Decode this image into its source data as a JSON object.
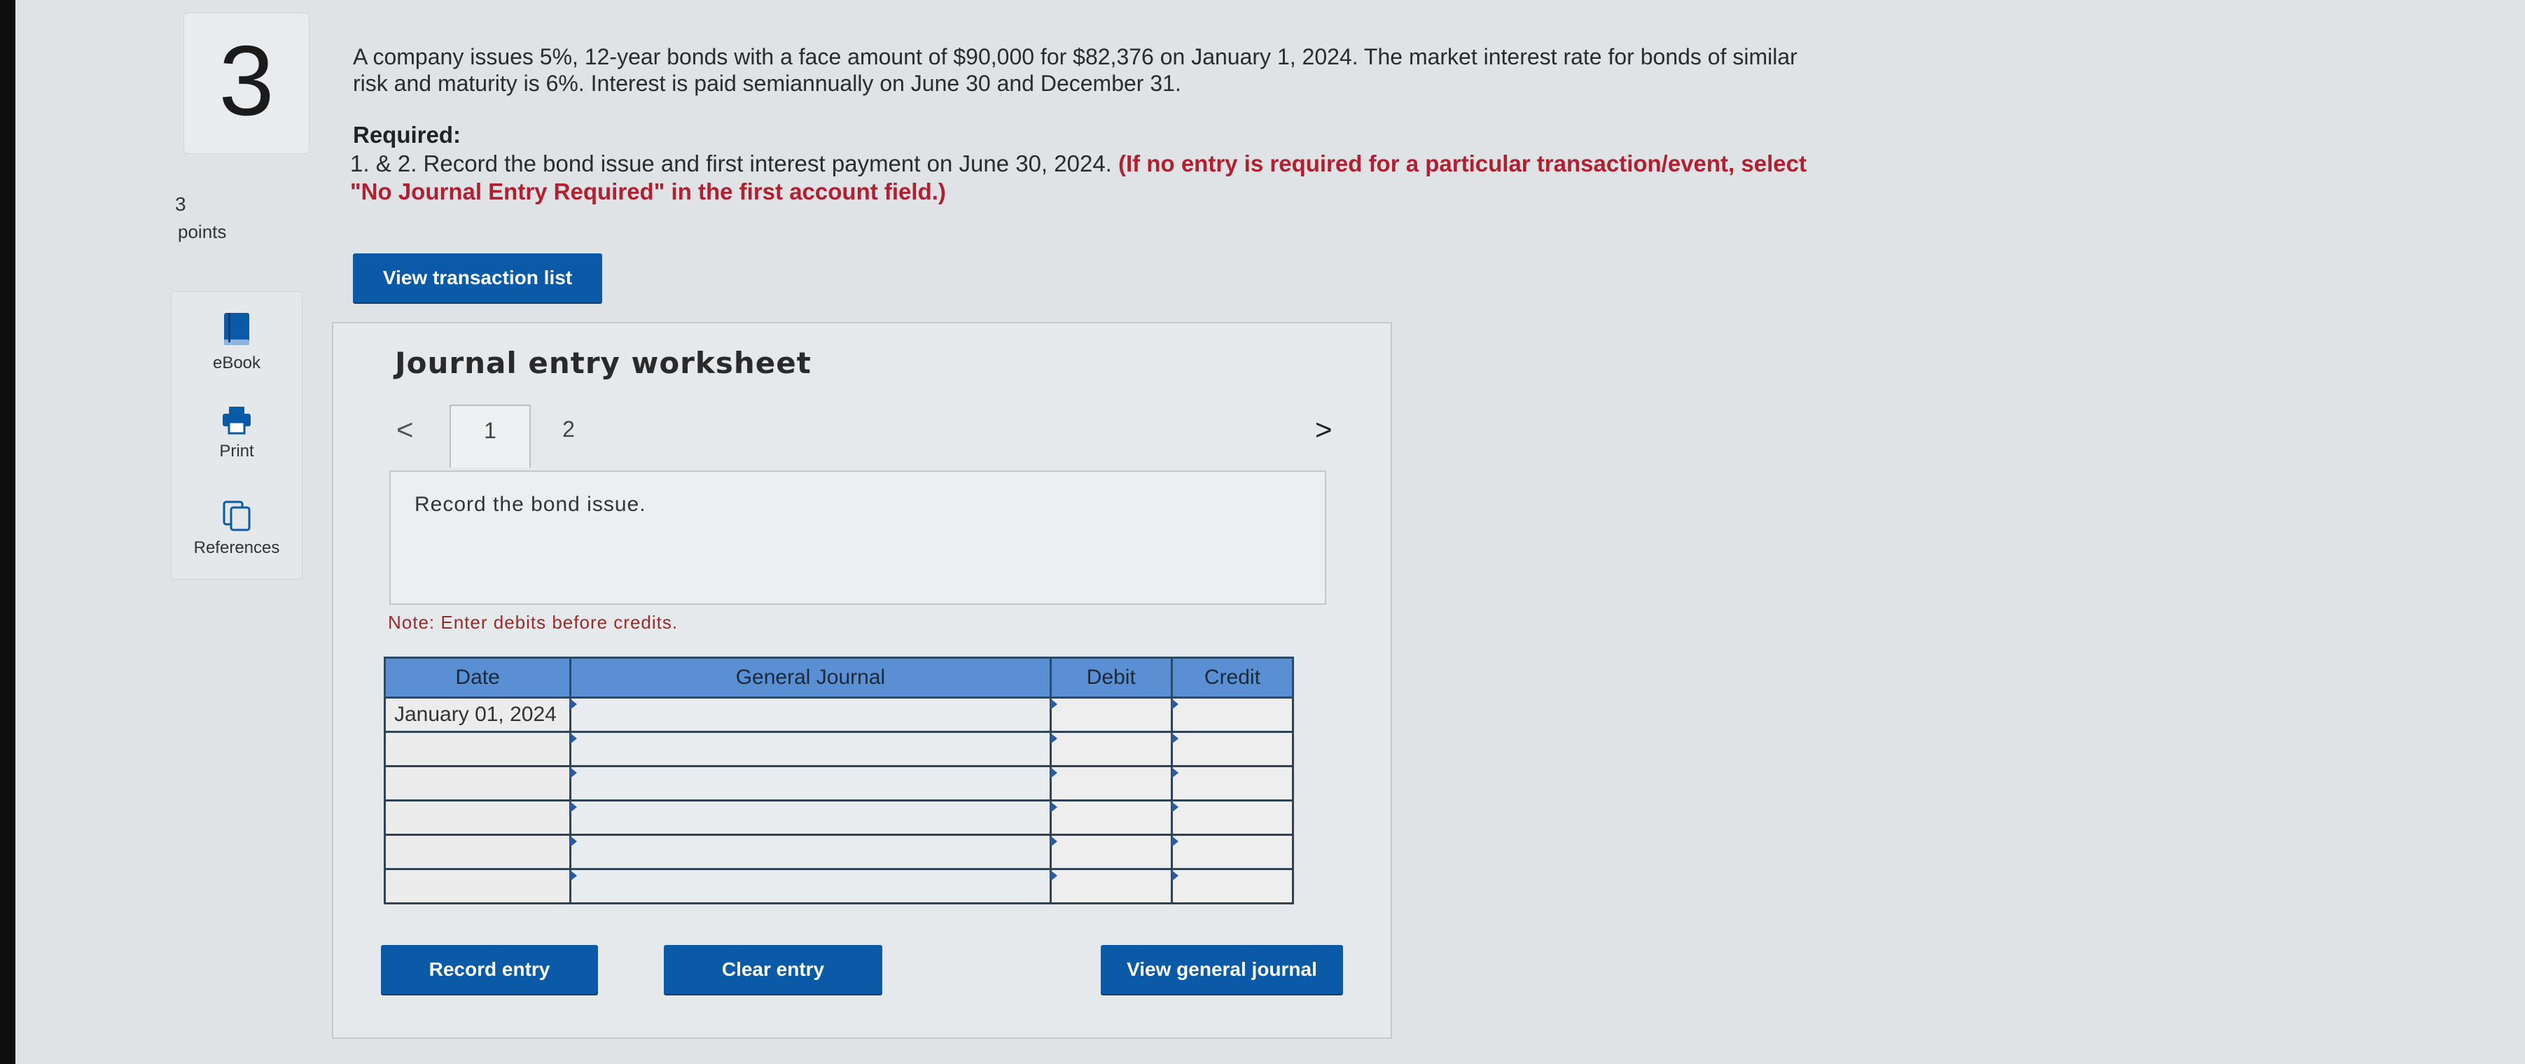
{
  "question": {
    "number": "3",
    "points_value": "3",
    "points_label": "points",
    "text": "A company issues 5%, 12-year bonds with a face amount of $90,000 for $82,376 on January 1, 2024. The market interest rate for bonds of similar risk and maturity is 6%. Interest is paid semiannually on June 30 and December 31.",
    "required_label": "Required:",
    "required_text": "1. & 2. Record the bond issue and first interest payment on June 30, 2024.",
    "required_note": "(If no entry is required for a particular transaction/event, select \"No Journal Entry Required\" in the first account field.)"
  },
  "tools": {
    "ebook": "eBook",
    "print": "Print",
    "references": "References"
  },
  "buttons": {
    "view_transaction_list": "View transaction list",
    "record_entry": "Record entry",
    "clear_entry": "Clear entry",
    "view_general_journal": "View general journal"
  },
  "worksheet": {
    "title": "Journal entry worksheet",
    "nav_prev": "<",
    "nav_next": ">",
    "tabs": [
      "1",
      "2"
    ],
    "instruction": "Record the bond issue.",
    "note": "Note: Enter debits before credits.",
    "columns": [
      "Date",
      "General Journal",
      "Debit",
      "Credit"
    ],
    "rows": [
      {
        "date": "January 01, 2024",
        "account": "",
        "debit": "",
        "credit": ""
      },
      {
        "date": "",
        "account": "",
        "debit": "",
        "credit": ""
      },
      {
        "date": "",
        "account": "",
        "debit": "",
        "credit": ""
      },
      {
        "date": "",
        "account": "",
        "debit": "",
        "credit": ""
      },
      {
        "date": "",
        "account": "",
        "debit": "",
        "credit": ""
      },
      {
        "date": "",
        "account": "",
        "debit": "",
        "credit": ""
      }
    ]
  },
  "colors": {
    "button_blue": "#0b5aa8",
    "header_blue": "#5b8fd3",
    "required_red": "#b02030"
  }
}
